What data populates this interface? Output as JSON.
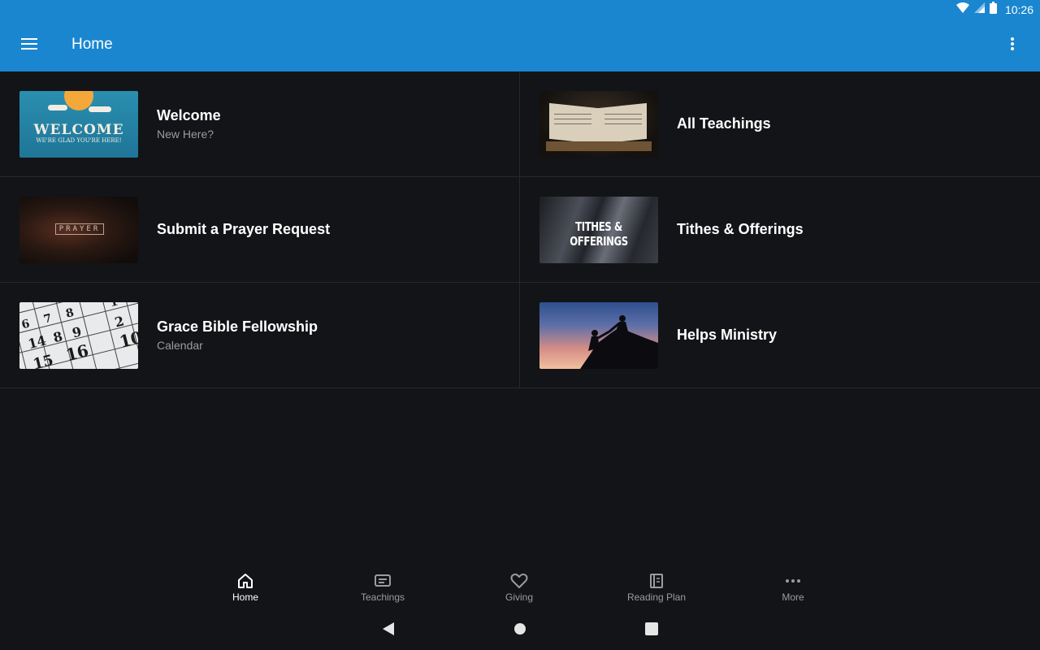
{
  "status_bar": {
    "time": "10:26",
    "icons": [
      "wifi-icon",
      "cell-signal-icon",
      "battery-icon"
    ]
  },
  "app_bar": {
    "title": "Home",
    "menu_icon": "hamburger-menu-icon",
    "overflow_icon": "more-vertical-icon"
  },
  "tiles": [
    {
      "title": "Welcome",
      "subtitle": "New Here?",
      "thumb": {
        "line1": "WELCOME",
        "line2": "WE'RE GLAD YOU'RE HERE!"
      }
    },
    {
      "title": "All Teachings",
      "subtitle": ""
    },
    {
      "title": "Submit a Prayer Request",
      "subtitle": "",
      "thumb": {
        "text": "PRAYER"
      }
    },
    {
      "title": "Tithes & Offerings",
      "subtitle": "",
      "thumb": {
        "text": "TITHES & OFFERINGS"
      }
    },
    {
      "title": "Grace Bible Fellowship",
      "subtitle": "Calendar"
    },
    {
      "title": "Helps Ministry",
      "subtitle": ""
    }
  ],
  "bottom_nav": [
    {
      "label": "Home",
      "icon": "home-icon",
      "active": true
    },
    {
      "label": "Teachings",
      "icon": "teachings-icon",
      "active": false
    },
    {
      "label": "Giving",
      "icon": "heart-icon",
      "active": false
    },
    {
      "label": "Reading Plan",
      "icon": "book-icon",
      "active": false
    },
    {
      "label": "More",
      "icon": "more-horizontal-icon",
      "active": false
    }
  ],
  "colors": {
    "app_bar": "#1a86d0",
    "background": "#131417",
    "divider": "#26282c",
    "muted_text": "#9a9ca0"
  }
}
